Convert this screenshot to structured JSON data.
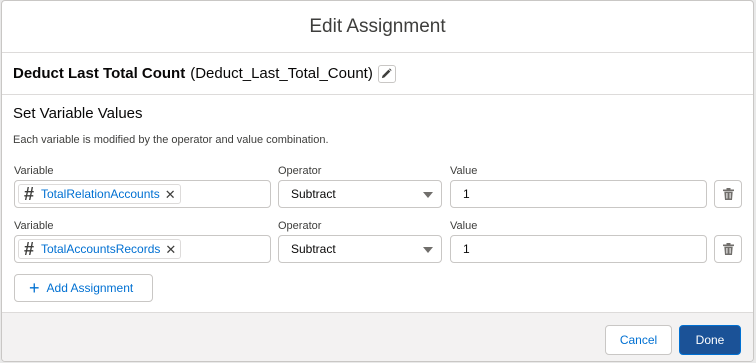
{
  "modal": {
    "title": "Edit Assignment"
  },
  "element": {
    "label": "Deduct Last Total Count",
    "api_name": "(Deduct_Last_Total_Count)",
    "edit_icon": "pencil-icon"
  },
  "section": {
    "title": "Set Variable Values",
    "description": "Each variable is modified by the operator and value combination."
  },
  "rows": [
    {
      "variable_label": "Variable",
      "variable_icon": "hash-icon",
      "variable_value": "TotalRelationAccounts",
      "operator_label": "Operator",
      "operator_value": "Subtract",
      "value_label": "Value",
      "value_value": "1",
      "delete_icon": "trash-icon"
    },
    {
      "variable_label": "Variable",
      "variable_icon": "hash-icon",
      "variable_value": "TotalAccountsRecords",
      "operator_label": "Operator",
      "operator_value": "Subtract",
      "value_label": "Value",
      "value_value": "1",
      "delete_icon": "trash-icon"
    }
  ],
  "add_button": {
    "label": "Add Assignment",
    "icon": "plus-icon"
  },
  "footer": {
    "cancel_label": "Cancel",
    "done_label": "Done"
  },
  "colors": {
    "brand": "#1b5297",
    "link": "#0070d2",
    "border": "#c9c7c5"
  }
}
